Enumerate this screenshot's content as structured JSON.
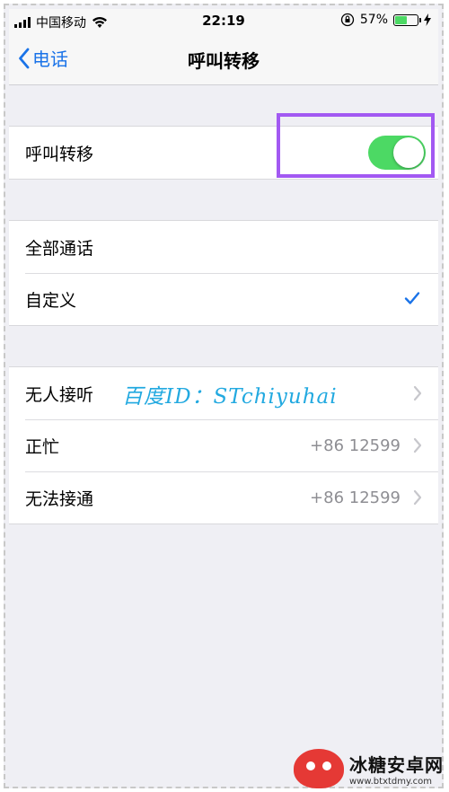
{
  "status": {
    "carrier": "中国移动",
    "time": "22:19",
    "battery_percent": "57%",
    "battery_level": 0.57,
    "icons": [
      "signal-icon",
      "wifi-icon",
      "rotation-lock-icon",
      "battery-icon",
      "charging-icon"
    ]
  },
  "nav": {
    "back_label": "电话",
    "title": "呼叫转移"
  },
  "forwarding": {
    "label": "呼叫转移",
    "enabled": true,
    "toggle_color": "#4cd964",
    "highlight_color": "#a259f2"
  },
  "scope": {
    "items": [
      {
        "label": "全部通话",
        "checked": false
      },
      {
        "label": "自定义",
        "checked": true
      }
    ],
    "check_color": "#1a73e8"
  },
  "conditions": {
    "items": [
      {
        "label": "无人接听",
        "value": ""
      },
      {
        "label": "正忙",
        "value": "+86 12599"
      },
      {
        "label": "无法接通",
        "value": "+86 12599"
      }
    ]
  },
  "watermark": "百度ID：STchiyuhai",
  "footer": {
    "brand": "冰糖安卓网",
    "url": "www.btxtdmy.com"
  }
}
